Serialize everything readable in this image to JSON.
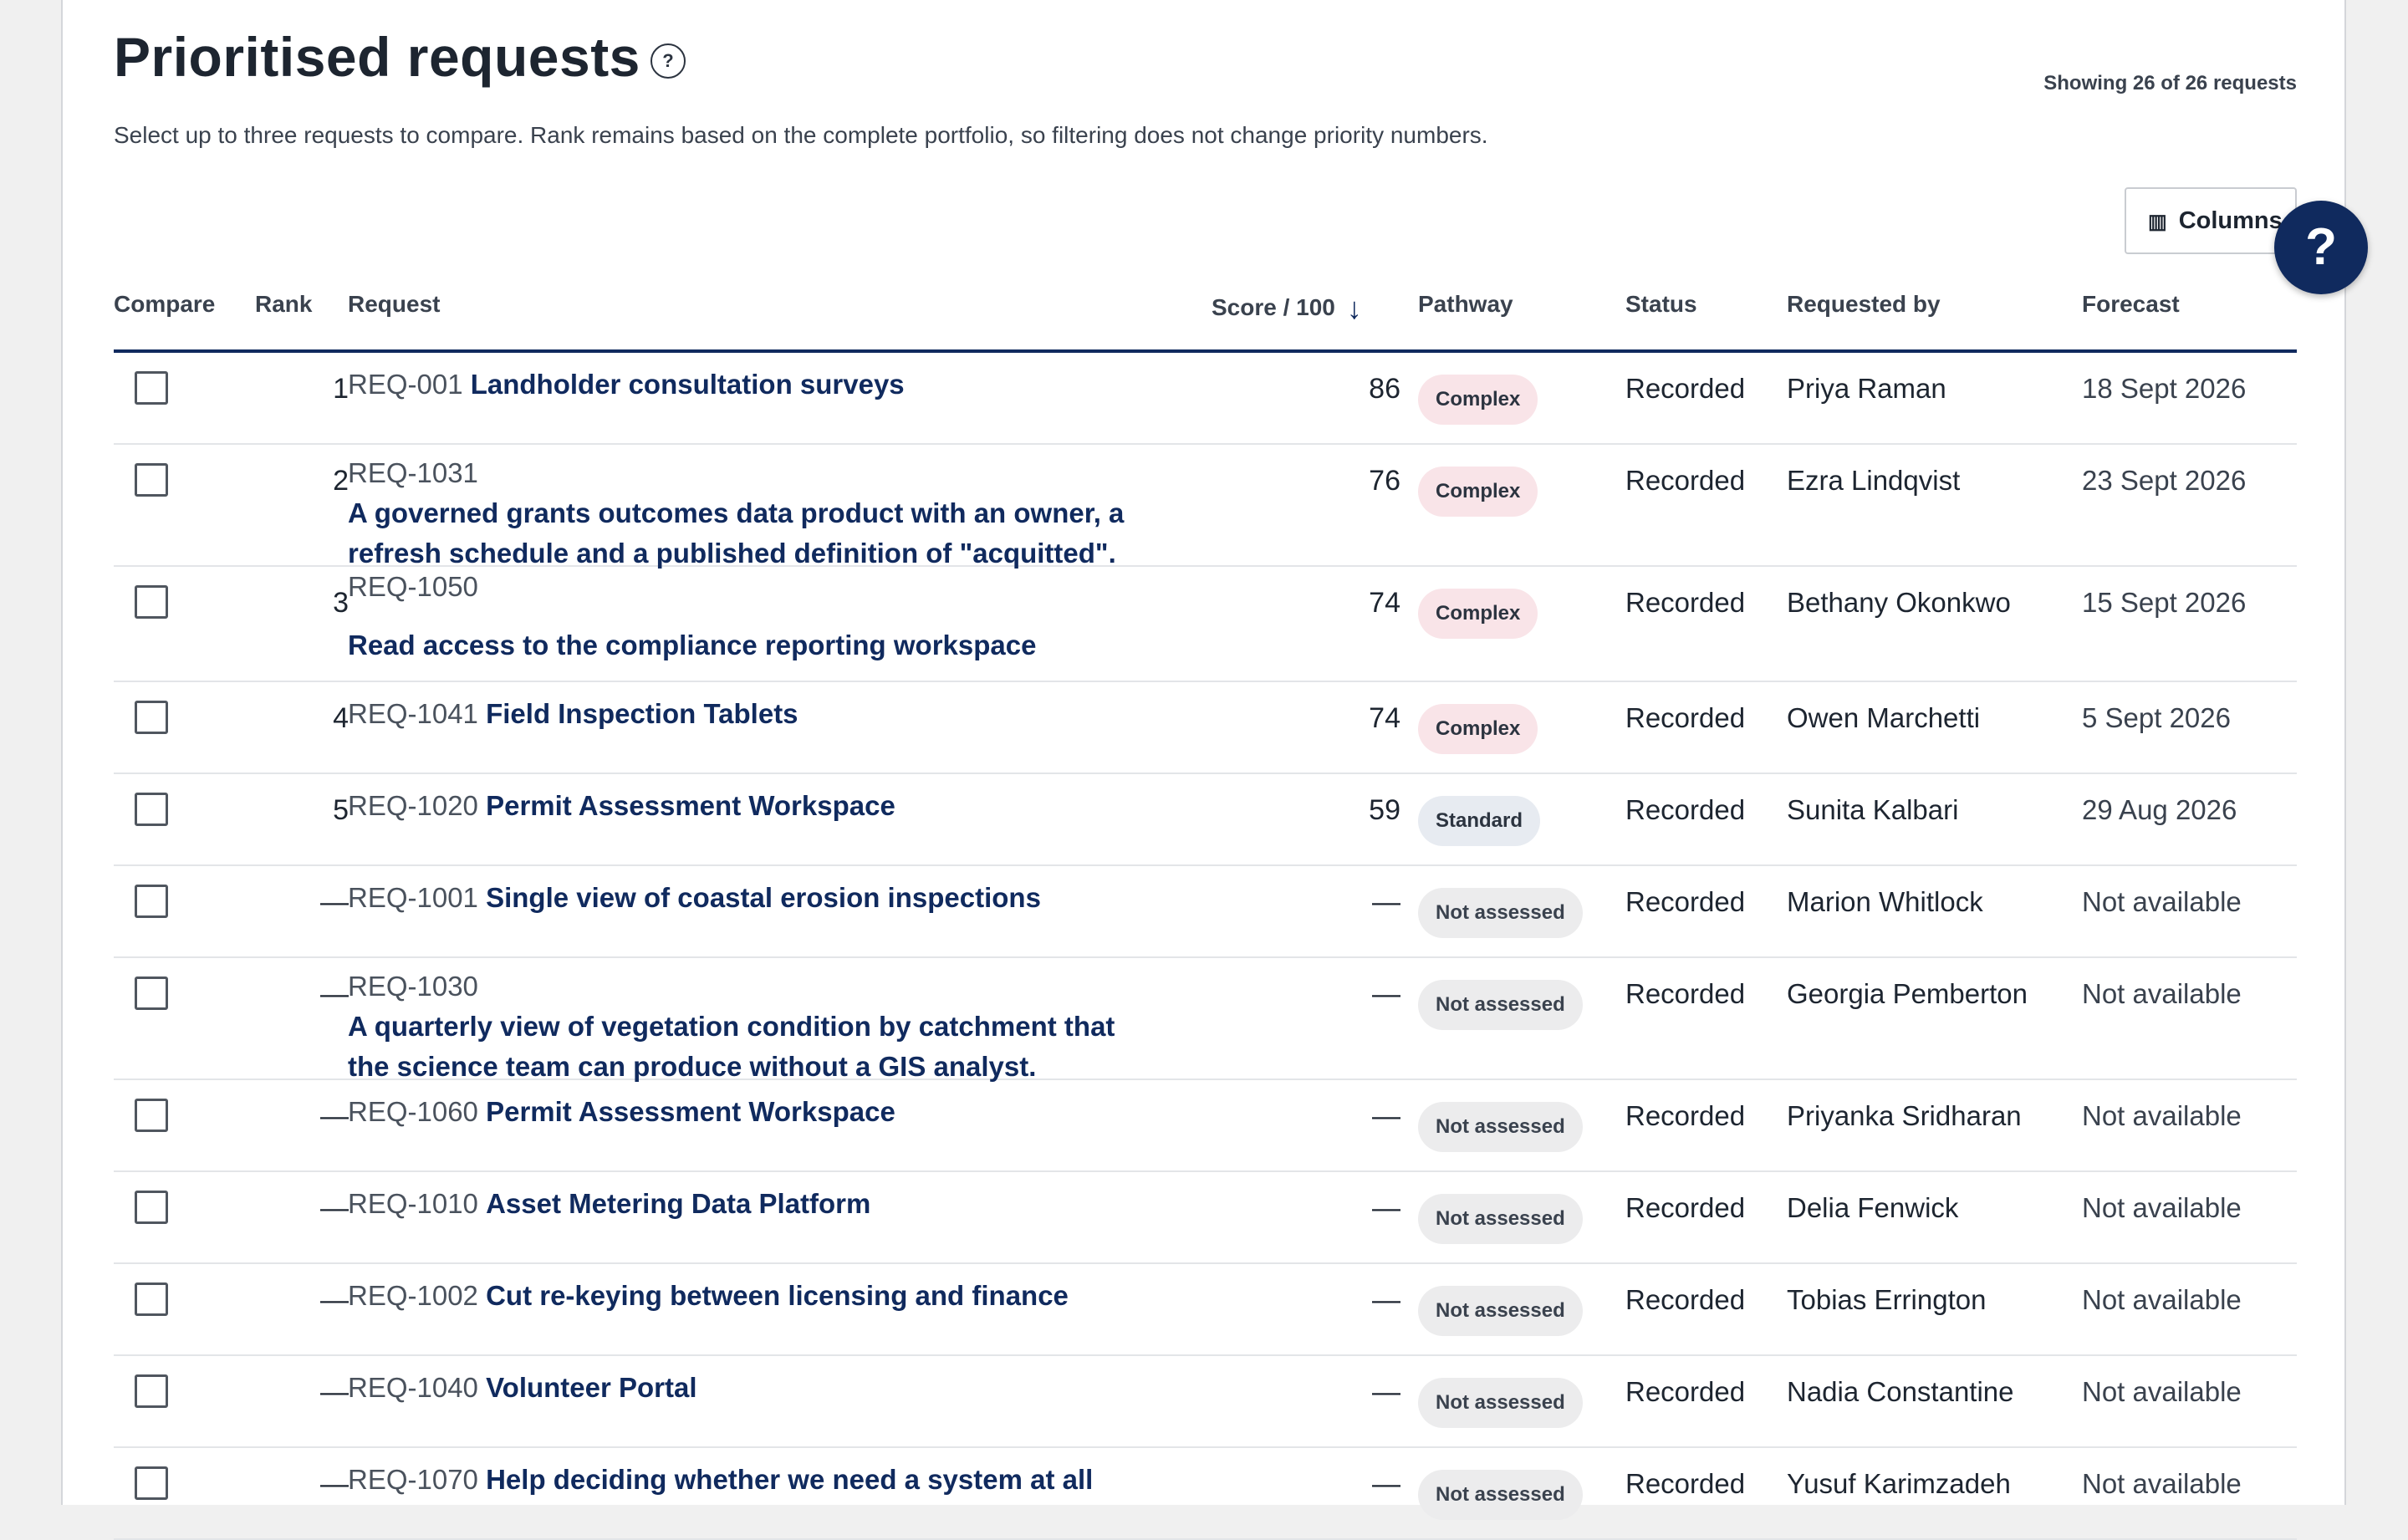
{
  "page": {
    "title": "Prioritised requests",
    "help_glyph": "?",
    "showing": "Showing 26 of 26 requests",
    "intro": "Select up to three requests to compare. Rank remains based on the complete portfolio, so filtering does not change priority numbers.",
    "columns_button": "Columns",
    "columns_icon": "columns-icon",
    "fab_glyph": "?"
  },
  "table": {
    "headers": {
      "compare": "Compare",
      "rank": "Rank",
      "request": "Request",
      "score": "Score / 100",
      "sort_glyph": "↓",
      "pathway": "Pathway",
      "status": "Status",
      "requested_by": "Requested by",
      "forecast": "Forecast"
    },
    "rows": [
      {
        "rank": "1",
        "id": "REQ-001",
        "title": "Landholder consultation surveys",
        "score": "86",
        "pathway": "Complex",
        "pathway_type": "complex",
        "status": "Recorded",
        "requested_by": "Priya Raman",
        "forecast": "18 Sept 2026"
      },
      {
        "rank": "2",
        "id": "REQ-1031",
        "title": "A governed grants outcomes data product with an owner, a refresh schedule and a published definition of \"acquitted\".",
        "score": "76",
        "pathway": "Complex",
        "pathway_type": "complex",
        "status": "Recorded",
        "requested_by": "Ezra Lindqvist",
        "forecast": "23 Sept 2026"
      },
      {
        "rank": "3",
        "id": "REQ-1050",
        "title": "Read access to the compliance reporting workspace",
        "score": "74",
        "pathway": "Complex",
        "pathway_type": "complex",
        "status": "Recorded",
        "requested_by": "Bethany Okonkwo",
        "forecast": "15 Sept 2026"
      },
      {
        "rank": "4",
        "id": "REQ-1041",
        "title": "Field Inspection Tablets",
        "score": "74",
        "pathway": "Complex",
        "pathway_type": "complex",
        "status": "Recorded",
        "requested_by": "Owen Marchetti",
        "forecast": "5 Sept 2026"
      },
      {
        "rank": "5",
        "id": "REQ-1020",
        "title": "Permit Assessment Workspace",
        "score": "59",
        "pathway": "Standard",
        "pathway_type": "standard",
        "status": "Recorded",
        "requested_by": "Sunita Kalbari",
        "forecast": "29 Aug 2026"
      },
      {
        "rank": "—",
        "id": "REQ-1001",
        "title": "Single view of coastal erosion inspections",
        "score": "—",
        "pathway": "Not assessed",
        "pathway_type": "na",
        "status": "Recorded",
        "requested_by": "Marion Whitlock",
        "forecast": "Not available"
      },
      {
        "rank": "—",
        "id": "REQ-1030",
        "title": "A quarterly view of vegetation condition by catchment that the science team can produce without a GIS analyst.",
        "score": "—",
        "pathway": "Not assessed",
        "pathway_type": "na",
        "status": "Recorded",
        "requested_by": "Georgia Pemberton",
        "forecast": "Not available"
      },
      {
        "rank": "—",
        "id": "REQ-1060",
        "title": "Permit Assessment Workspace",
        "score": "—",
        "pathway": "Not assessed",
        "pathway_type": "na",
        "status": "Recorded",
        "requested_by": "Priyanka Sridharan",
        "forecast": "Not available"
      },
      {
        "rank": "—",
        "id": "REQ-1010",
        "title": "Asset Metering Data Platform",
        "score": "—",
        "pathway": "Not assessed",
        "pathway_type": "na",
        "status": "Recorded",
        "requested_by": "Delia Fenwick",
        "forecast": "Not available"
      },
      {
        "rank": "—",
        "id": "REQ-1002",
        "title": "Cut re-keying between licensing and finance",
        "score": "—",
        "pathway": "Not assessed",
        "pathway_type": "na",
        "status": "Recorded",
        "requested_by": "Tobias Errington",
        "forecast": "Not available"
      },
      {
        "rank": "—",
        "id": "REQ-1040",
        "title": "Volunteer Portal",
        "score": "—",
        "pathway": "Not assessed",
        "pathway_type": "na",
        "status": "Recorded",
        "requested_by": "Nadia Constantine",
        "forecast": "Not available"
      },
      {
        "rank": "—",
        "id": "REQ-1070",
        "title": "Help deciding whether we need a system at all",
        "score": "—",
        "pathway": "Not assessed",
        "pathway_type": "na",
        "status": "Recorded",
        "requested_by": "Yusuf Karimzadeh",
        "forecast": "Not available"
      }
    ]
  }
}
